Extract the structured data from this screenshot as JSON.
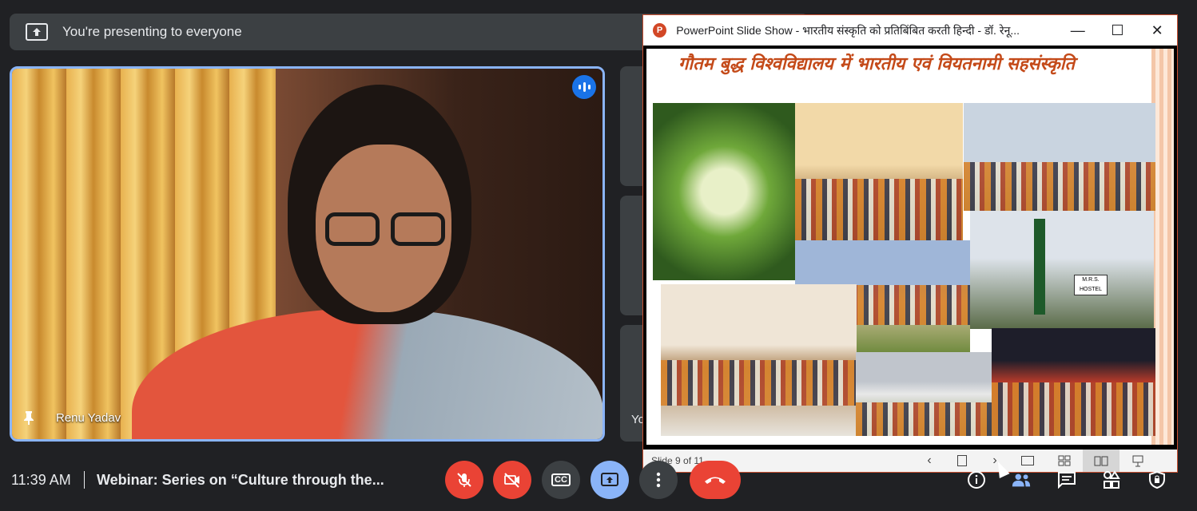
{
  "banner": {
    "text": "You're presenting to everyone",
    "icon": "present-screen-icon"
  },
  "main_tile": {
    "participant_name": "Renu Yadav",
    "speaking_icon": "audio-level-icon",
    "pin_icon": "pin-icon"
  },
  "side_tile": {
    "partial_label": "Yo"
  },
  "ppt_window": {
    "title": "PowerPoint Slide Show  -  भारतीय संस्कृति को प्रतिबिंबित करती हिन्दी - डॉ. रेनू...",
    "app_icon_letter": "P",
    "minimize": "—",
    "maximize": "☐",
    "close": "✕",
    "slide": {
      "heading": "गौतम बुद्ध विश्वविद्यालय में भारतीय एवं वियतनामी सहसंस्कृति",
      "photo_label": "M.R.S. HOSTEL"
    },
    "status": {
      "slide_counter": "Slide 9 of 11",
      "prev": "‹",
      "next": "›"
    }
  },
  "bottom_bar": {
    "time": "11:39 AM",
    "meeting_title": "Webinar: Series on “Culture through the...",
    "controls": [
      {
        "name": "mic-off-button",
        "icon": "mic-off-icon"
      },
      {
        "name": "camera-off-button",
        "icon": "camera-off-icon"
      },
      {
        "name": "captions-button",
        "icon": "captions-icon",
        "label": "CC"
      },
      {
        "name": "present-button",
        "icon": "present-icon"
      },
      {
        "name": "more-options-button",
        "icon": "more-vert-icon"
      },
      {
        "name": "end-call-button",
        "icon": "end-call-icon"
      }
    ],
    "right_icons": [
      "info-icon",
      "people-icon",
      "chat-icon",
      "activities-icon",
      "host-controls-icon"
    ]
  },
  "colors": {
    "background": "#202124",
    "tile_border": "#8ab4f8",
    "danger": "#ea4335",
    "heading_orange": "#c44a19"
  }
}
